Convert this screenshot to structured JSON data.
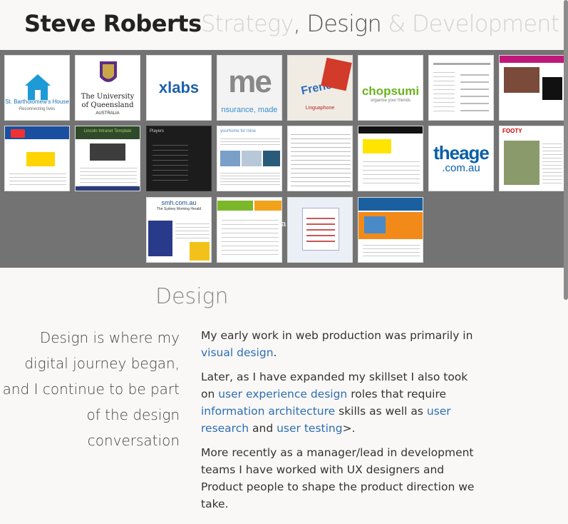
{
  "header": {
    "name": "Steve Roberts",
    "tagline": {
      "strategy": "Strategy",
      "comma": ",",
      "design": "Design",
      "amp": "&",
      "development": "Development"
    }
  },
  "gallery": {
    "thumbs": [
      {
        "label": "St. Bartholomew's House",
        "sub": "Reconnecting lives"
      },
      {
        "label": "The University of Queensland",
        "sub": "AUSTRALIA"
      },
      {
        "label": "xlabs"
      },
      {
        "label": "me",
        "sub": "nsurance, made"
      },
      {
        "label": "French",
        "sub": "Linguaphone"
      },
      {
        "label": "chopsumi",
        "sub": "organise your friends"
      },
      {
        "label": "theage",
        "sub": ".com.au"
      },
      {
        "label": "smh.com.au",
        "sub": "The Sydney Morning Herald"
      },
      {
        "label": "yourhome for mine"
      },
      {
        "label": "Lincoln Intranet Template"
      },
      {
        "label": "Players"
      },
      {
        "label": "FOOTY"
      }
    ],
    "overlay": "a"
  },
  "section": {
    "title": "Design"
  },
  "quote": {
    "line1": "Design is where my",
    "line2": "digital journey began,",
    "line3": "and I continue to be part",
    "line4": "of the design",
    "line5": "conversation"
  },
  "copy": {
    "p1_a": "My early work in web production was primarily in",
    "p1_link": "visual design",
    "p1_b": ".",
    "p2_a": "Later, as I have expanded my skillset I also took on",
    "p2_link1": "user experience design",
    "p2_b": "roles that require",
    "p2_link2": "information architecture",
    "p2_c": "skills as well as",
    "p2_link3": "user research",
    "p2_d": "and",
    "p2_link4": "user testing",
    "p2_e": ">.",
    "p3": "More recently as a manager/lead in development teams I have worked with UX designers and Product people to shape the product direction we take."
  },
  "colors": {
    "accent": "#2c6db5",
    "gallery_bg": "#737373",
    "page_bg": "#f9f8f6"
  }
}
